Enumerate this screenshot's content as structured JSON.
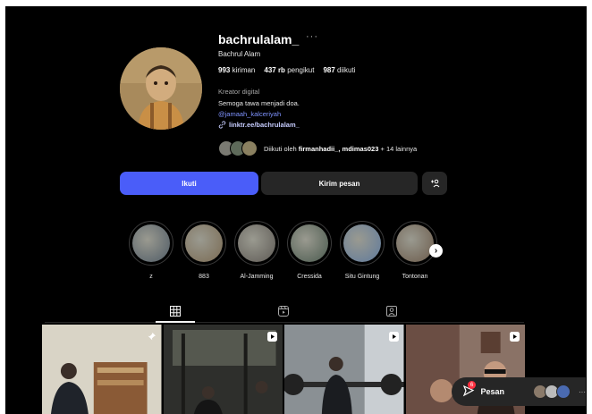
{
  "profile": {
    "username": "bachrulalam_",
    "more": "···",
    "full_name": "Bachrul Alam",
    "stats": {
      "posts_value": "993",
      "posts_label": "kiriman",
      "followers_value": "437 rb",
      "followers_label": "pengikut",
      "following_value": "987",
      "following_label": "diikuti"
    },
    "category": "Kreator digital",
    "bio": "Semoga tawa menjadi doa.",
    "mention": "@jamaah_kalceriyah",
    "link": "linktr.ee/bachrulalam_",
    "followed_prefix": "Diikuti oleh",
    "followed_names": "firmanhadii_, mdimas023",
    "followed_suffix": "+ 14 lainnya"
  },
  "actions": {
    "follow_label": "Ikuti",
    "message_label": "Kirim pesan",
    "suggest_icon": "add-person-icon"
  },
  "highlights": [
    {
      "label": "z",
      "color": "#4f5b66"
    },
    {
      "label": "883",
      "color": "#7a6a52"
    },
    {
      "label": "Al-Jamming",
      "color": "#5e5a55"
    },
    {
      "label": "Cressida",
      "color": "#4a5a4e"
    },
    {
      "label": "Situ Gintung",
      "color": "#5f7a9c"
    },
    {
      "label": "Tontonan",
      "color": "#6b5a4a"
    }
  ],
  "tabs": [
    {
      "name": "posts",
      "icon": "grid-icon",
      "active": true
    },
    {
      "name": "reels",
      "icon": "reels-icon",
      "active": false
    },
    {
      "name": "tagged",
      "icon": "tagged-icon",
      "active": false
    }
  ],
  "posts": [
    {
      "badge": "pin-icon",
      "color": "#6b5c4a"
    },
    {
      "badge": "reel-icon",
      "color": "#3a3a36"
    },
    {
      "badge": "reel-icon",
      "color": "#5a6066"
    },
    {
      "badge": "reel-icon",
      "color": "#7a5e52"
    }
  ],
  "messages_dock": {
    "label": "Pesan",
    "unread": "6",
    "more": "···"
  },
  "colors": {
    "background": "#000000",
    "follow_button": "#4a5df9",
    "secondary_button": "#262626",
    "link": "#7f93ff"
  }
}
